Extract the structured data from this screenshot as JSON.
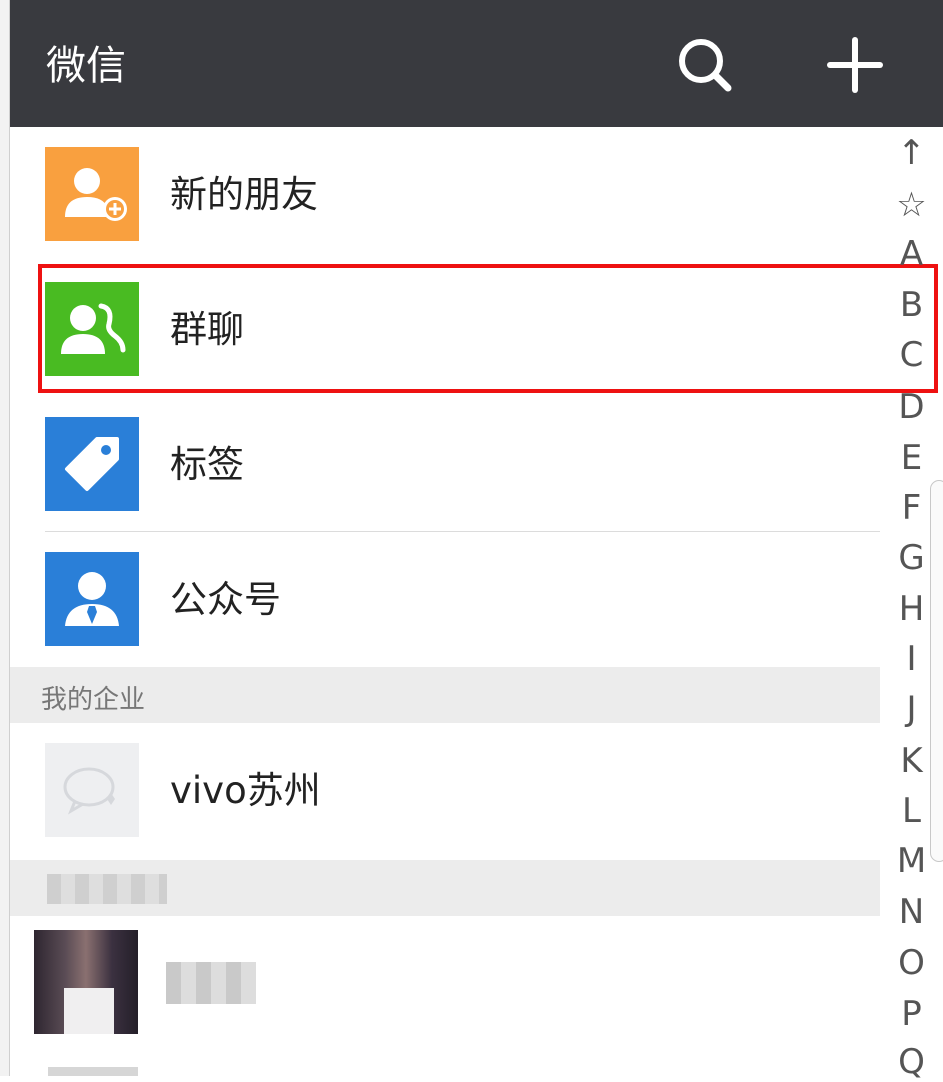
{
  "header": {
    "title": "微信",
    "search_icon": "search-icon",
    "add_icon": "plus-icon"
  },
  "entries": [
    {
      "label": "新的朋友",
      "icon": "add-friend-icon",
      "color": "#f9a03f"
    },
    {
      "label": "群聊",
      "icon": "group-chat-icon",
      "color": "#49bb22"
    },
    {
      "label": "标签",
      "icon": "tag-icon",
      "color": "#2a7fd8"
    },
    {
      "label": "公众号",
      "icon": "official-account-icon",
      "color": "#2a7fd8"
    }
  ],
  "enterprise_section": {
    "header": "我的企业",
    "items": [
      {
        "label": "vivo苏州",
        "icon": "enterprise-chat-icon"
      }
    ]
  },
  "index_letters": [
    "↑",
    "☆",
    "A",
    "B",
    "C",
    "D",
    "E",
    "F",
    "G",
    "H",
    "I",
    "J",
    "K",
    "L",
    "M",
    "N",
    "O",
    "P",
    "Q"
  ],
  "colors": {
    "topbar": "#393a3f",
    "highlight": "#ee1111"
  }
}
